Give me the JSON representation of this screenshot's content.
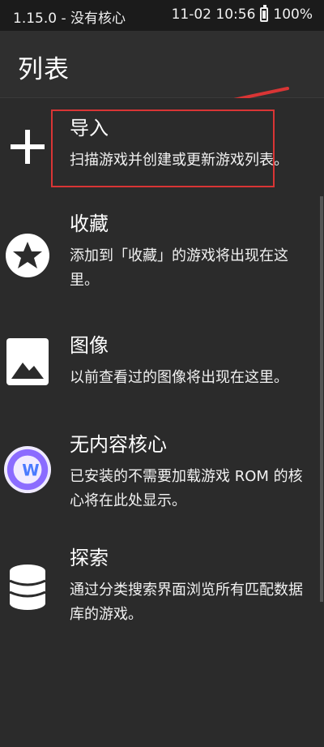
{
  "status_bar": {
    "left_text": "1.15.0 - 没有核心",
    "time": "11-02 10:56",
    "battery": "100%",
    "battery_icon": "battery-charging-icon"
  },
  "app_bar": {
    "title": "列表"
  },
  "items": [
    {
      "label": "导入",
      "description": "扫描游戏并创建或更新游戏列表。",
      "icon": "plus-icon"
    },
    {
      "label": "收藏",
      "description": "添加到「收藏」的游戏将出现在这里。",
      "icon": "star-icon"
    },
    {
      "label": "图像",
      "description": "以前查看过的图像将出现在这里。",
      "icon": "image-icon"
    },
    {
      "label": "无内容核心",
      "description": "已安装的不需要加载游戏 ROM 的核心将在此处显示。",
      "icon": "core-app-icon"
    },
    {
      "label": "探索",
      "description": "通过分类搜索界面浏览所有匹配数据库的游戏。",
      "icon": "database-icon"
    }
  ],
  "colors": {
    "background": "#2b2b2b",
    "status_bar": "#1b1b1b",
    "highlight_border": "#d93535",
    "arrow": "#d93535"
  }
}
